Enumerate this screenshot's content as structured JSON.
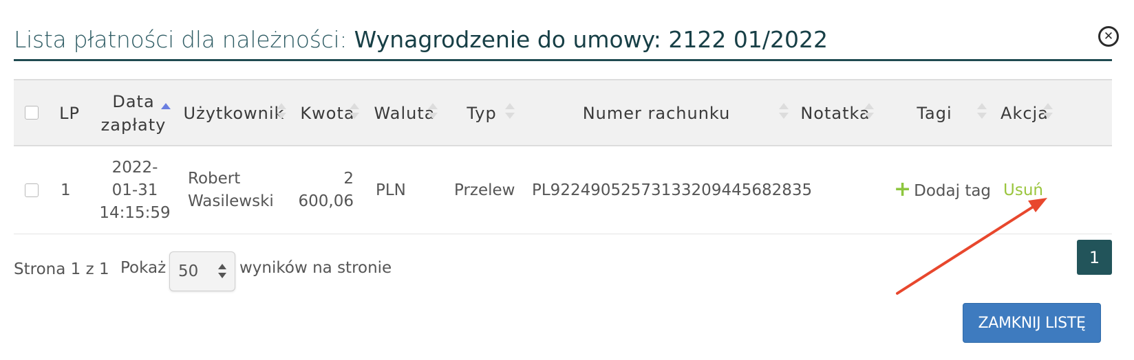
{
  "dialog": {
    "title_prefix": "Lista płatności dla należności:",
    "title_subject": "Wynagrodzenie do umowy: 2122 01/2022",
    "close_icon": "close-circle-icon"
  },
  "table": {
    "columns": [
      {
        "key": "lp",
        "label": "LP"
      },
      {
        "key": "date",
        "label": "Data zapłaty",
        "sort": "asc"
      },
      {
        "key": "user",
        "label": "Użytkownik"
      },
      {
        "key": "amount",
        "label": "Kwota"
      },
      {
        "key": "currency",
        "label": "Waluta"
      },
      {
        "key": "type",
        "label": "Typ"
      },
      {
        "key": "account",
        "label": "Numer rachunku"
      },
      {
        "key": "note",
        "label": "Notatka"
      },
      {
        "key": "tags",
        "label": "Tagi"
      },
      {
        "key": "action",
        "label": "Akcja"
      }
    ],
    "rows": [
      {
        "lp": "1",
        "date": "2022-01-31 14:15:59",
        "user": "Robert Wasilewski",
        "amount": "2 600,06",
        "currency": "PLN",
        "type": "Przelew",
        "account": "PL92249052573133209445682835",
        "note": "",
        "add_tag_label": "Dodaj tag",
        "action_label": "Usuń"
      }
    ]
  },
  "pagination": {
    "page_info": "Strona 1 z 1",
    "show_label": "Pokaż",
    "per_page_value": "50",
    "per_page_suffix": "wyników na stronie",
    "current_page": "1"
  },
  "footer": {
    "close_list_label": "ZAMKNIJ LISTĘ"
  },
  "colors": {
    "title_underline": "#1f4a50",
    "page_button": "#22545a",
    "primary_button": "#3e7bbf",
    "delete_link": "#9ac53d",
    "annotation_arrow": "#e8472d"
  }
}
